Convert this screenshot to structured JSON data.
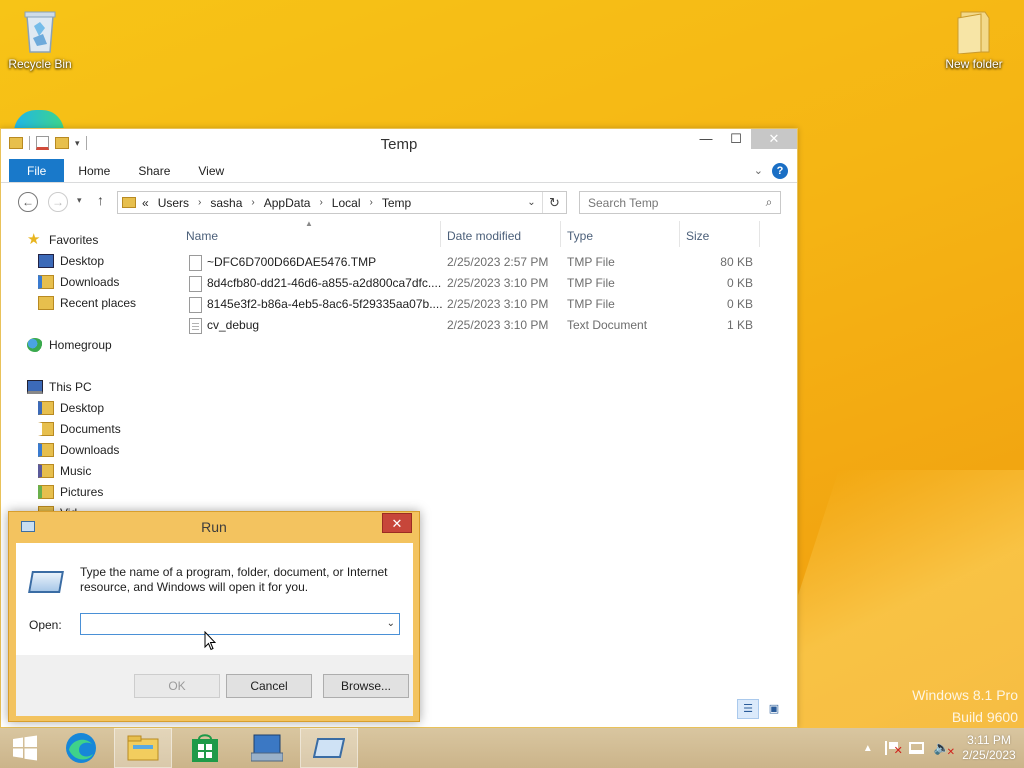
{
  "desktop": {
    "icons": [
      {
        "label": "Recycle Bin"
      },
      {
        "label": "New folder"
      }
    ]
  },
  "explorer": {
    "title": "Temp",
    "ribbon_tabs": [
      "File",
      "Home",
      "Share",
      "View"
    ],
    "breadcrumb": [
      "«",
      "Users",
      "sasha",
      "AppData",
      "Local",
      "Temp"
    ],
    "search_placeholder": "Search Temp",
    "nav": {
      "favorites": "Favorites",
      "fav_items": [
        "Desktop",
        "Downloads",
        "Recent places"
      ],
      "homegroup": "Homegroup",
      "this_pc": "This PC",
      "pc_items": [
        "Desktop",
        "Documents",
        "Downloads",
        "Music",
        "Pictures",
        "Vid"
      ]
    },
    "columns": {
      "name": "Name",
      "date": "Date modified",
      "type": "Type",
      "size": "Size"
    },
    "files": [
      {
        "name": "~DFC6D700D66DAE5476.TMP",
        "date": "2/25/2023 2:57 PM",
        "type": "TMP File",
        "size": "80 KB",
        "icon": "file-icon"
      },
      {
        "name": "8d4cfb80-dd21-46d6-a855-a2d800ca7dfc....",
        "date": "2/25/2023 3:10 PM",
        "type": "TMP File",
        "size": "0 KB",
        "icon": "file-icon"
      },
      {
        "name": "8145e3f2-b86a-4eb5-8ac6-5f29335aa07b....",
        "date": "2/25/2023 3:10 PM",
        "type": "TMP File",
        "size": "0 KB",
        "icon": "file-icon"
      },
      {
        "name": "cv_debug",
        "date": "2/25/2023 3:10 PM",
        "type": "Text Document",
        "size": "1 KB",
        "icon": "text-file-icon"
      }
    ]
  },
  "run": {
    "title": "Run",
    "description": "Type the name of a program, folder, document, or Internet resource, and Windows will open it for you.",
    "open_label": "Open:",
    "open_value": "",
    "ok": "OK",
    "cancel": "Cancel",
    "browse": "Browse..."
  },
  "taskbar": {
    "time": "3:11 PM",
    "date": "2/25/2023"
  },
  "watermark": {
    "line1": "Windows 8.1 Pro",
    "line2": "Build 9600"
  },
  "colors": {
    "desktop": "#f5b414",
    "file_tab": "#1979ca",
    "run_border": "#f3c35f",
    "close_red": "#c7463a"
  }
}
